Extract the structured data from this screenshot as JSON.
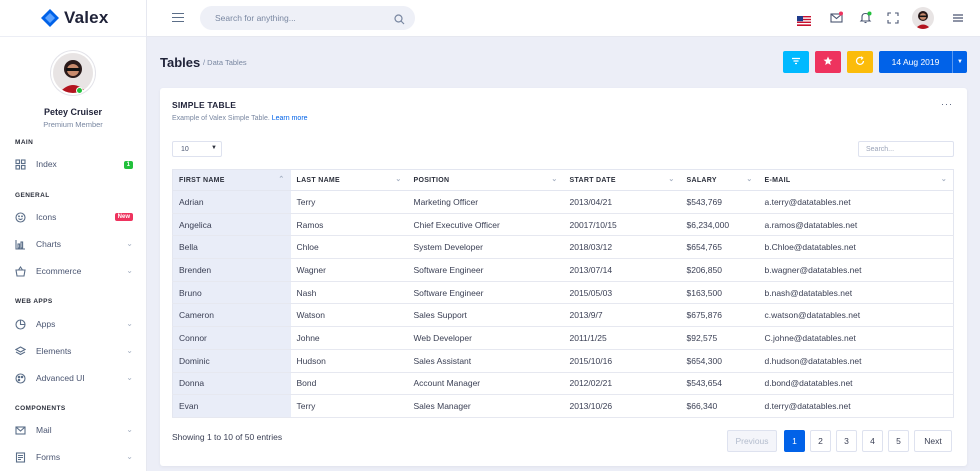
{
  "brand": {
    "name": "Valex"
  },
  "user": {
    "name": "Petey Cruiser",
    "role": "Premium Member"
  },
  "sidebar": {
    "sections": [
      {
        "title": "MAIN"
      },
      {
        "title": "GENERAL"
      },
      {
        "title": "WEB APPS"
      },
      {
        "title": "COMPONENTS"
      }
    ],
    "items": [
      {
        "label": "Index",
        "badge": "1",
        "icon": "grid-icon"
      },
      {
        "label": "Icons",
        "badge": "New",
        "icon": "smile-icon"
      },
      {
        "label": "Charts",
        "icon": "bar-chart-icon"
      },
      {
        "label": "Ecommerce",
        "icon": "basket-icon"
      },
      {
        "label": "Apps",
        "icon": "pie-icon"
      },
      {
        "label": "Elements",
        "icon": "layers-icon"
      },
      {
        "label": "Advanced UI",
        "icon": "palette-icon"
      },
      {
        "label": "Mail",
        "icon": "mail-icon"
      },
      {
        "label": "Forms",
        "icon": "form-icon"
      }
    ]
  },
  "topbar": {
    "search_placeholder": "Search for anything..."
  },
  "header": {
    "title": "Tables",
    "breadcrumb": "/ Data Tables",
    "date": "14 Aug 2019"
  },
  "card": {
    "title": "SIMPLE TABLE",
    "subtitle": "Example of Valex Simple Table.",
    "subtitle_link": "Learn more",
    "page_length": "10",
    "search_placeholder": "Search...",
    "columns": [
      "FIRST NAME",
      "LAST NAME",
      "POSITION",
      "START DATE",
      "SALARY",
      "E-MAIL"
    ],
    "rows": [
      [
        "Adrian",
        "Terry",
        "Marketing Officer",
        "2013/04/21",
        "$543,769",
        "a.terry@datatables.net"
      ],
      [
        "Angelica",
        "Ramos",
        "Chief Executive Officer",
        "20017/10/15",
        "$6,234,000",
        "a.ramos@datatables.net"
      ],
      [
        "Bella",
        "Chloe",
        "System Developer",
        "2018/03/12",
        "$654,765",
        "b.Chloe@datatables.net"
      ],
      [
        "Brenden",
        "Wagner",
        "Software Engineer",
        "2013/07/14",
        "$206,850",
        "b.wagner@datatables.net"
      ],
      [
        "Bruno",
        "Nash",
        "Software Engineer",
        "2015/05/03",
        "$163,500",
        "b.nash@datatables.net"
      ],
      [
        "Cameron",
        "Watson",
        "Sales Support",
        "2013/9/7",
        "$675,876",
        "c.watson@datatables.net"
      ],
      [
        "Connor",
        "Johne",
        "Web Developer",
        "2011/1/25",
        "$92,575",
        "C.johne@datatables.net"
      ],
      [
        "Dominic",
        "Hudson",
        "Sales Assistant",
        "2015/10/16",
        "$654,300",
        "d.hudson@datatables.net"
      ],
      [
        "Donna",
        "Bond",
        "Account Manager",
        "2012/02/21",
        "$543,654",
        "d.bond@datatables.net"
      ],
      [
        "Evan",
        "Terry",
        "Sales Manager",
        "2013/10/26",
        "$66,340",
        "d.terry@datatables.net"
      ]
    ],
    "info": "Showing 1 to 10 of 50 entries",
    "pagination": {
      "previous": "Previous",
      "pages": [
        "1",
        "2",
        "3",
        "4",
        "5"
      ],
      "next": "Next",
      "current": "1"
    }
  },
  "colors": {
    "primary": "#0162e8",
    "info": "#00b9ff",
    "danger": "#ee335e",
    "warning": "#fbbc0b",
    "success": "#22c03c"
  }
}
